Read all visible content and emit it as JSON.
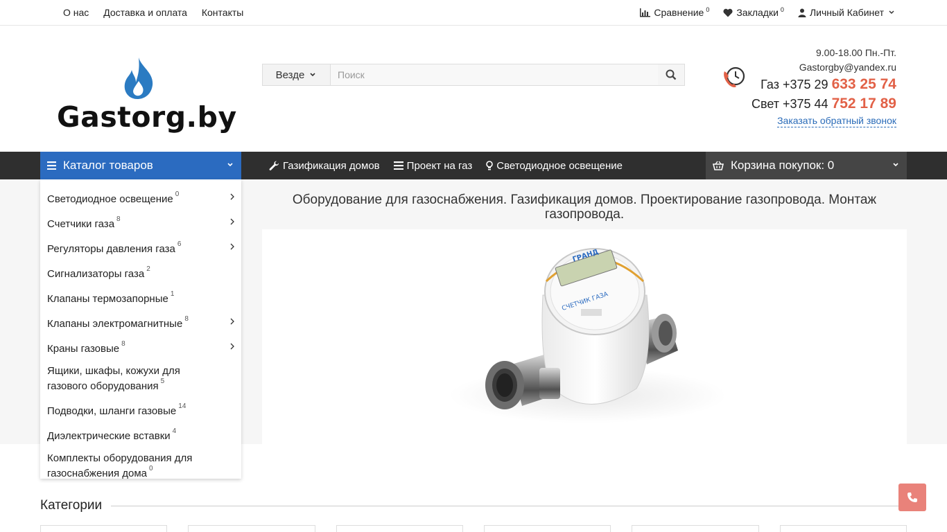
{
  "topbar": {
    "links": [
      "О нас",
      "Доставка и оплата",
      "Контакты"
    ],
    "compare": {
      "label": "Сравнение",
      "count": "0"
    },
    "bookmarks": {
      "label": "Закладки",
      "count": "0"
    },
    "account": {
      "label": "Личный Кабинет"
    }
  },
  "logo": {
    "text": "Gastorg.by"
  },
  "search": {
    "scope": "Везде",
    "placeholder": "Поиск"
  },
  "contacts": {
    "hours": "9.00-18.00 Пн.-Пт.",
    "email": "Gastorgby@yandex.ru",
    "phone1_prefix": "Газ +375 29",
    "phone1_number": "633 25 74",
    "phone2_prefix": "Свет +375 44",
    "phone2_number": "752 17 89",
    "callback": "Заказать обратный звонок"
  },
  "nav": {
    "catalog": "Каталог товаров",
    "links": [
      "Газификация домов",
      "Проект на газ",
      "Светодиодное освещение"
    ],
    "cart": "Корзина покупок: 0"
  },
  "hero": {
    "title": "Оборудование для газоснабжения. Газификация домов. Проектирование газопровода. Монтаж газопровода."
  },
  "sidebar": {
    "items": [
      {
        "label": "Светодиодное освещение",
        "count": "0"
      },
      {
        "label": "Счетчики газа",
        "count": "8"
      },
      {
        "label": "Регуляторы давления газа",
        "count": "6"
      },
      {
        "label": "Сигнализаторы газа",
        "count": "2"
      },
      {
        "label": "Клапаны термозапорные",
        "count": "1"
      },
      {
        "label": "Клапаны электромагнитные",
        "count": "8"
      },
      {
        "label": "Краны газовые",
        "count": "8"
      },
      {
        "label": "Ящики, шкафы, кожухи для газового оборудования",
        "count": "5"
      },
      {
        "label": "Подводки, шланги газовые",
        "count": "14"
      },
      {
        "label": "Диэлектрические вставки",
        "count": "4"
      },
      {
        "label": "Комплекты оборудования для газоснабжения дома",
        "count": "0"
      }
    ]
  },
  "categories": {
    "heading": "Категории"
  },
  "colors": {
    "accent_blue": "#2b6bc0",
    "phone_red": "#e26147",
    "nav_dark": "#2f2f2f"
  }
}
